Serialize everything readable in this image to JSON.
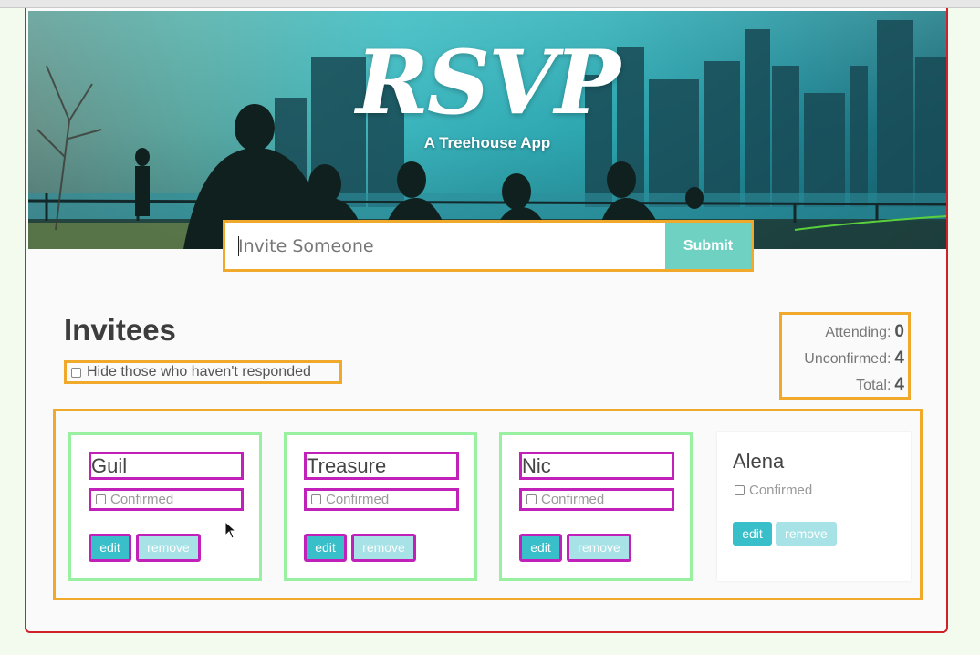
{
  "header": {
    "logo_text": "RSVP",
    "subtitle": "A Treehouse App"
  },
  "invite_form": {
    "placeholder": "Invite Someone",
    "submit_label": "Submit"
  },
  "main": {
    "title": "Invitees",
    "filter_label": "Hide those who haven't responded",
    "counter": {
      "attending_label": "Attending:",
      "attending_value": "0",
      "unconfirmed_label": "Unconfirmed:",
      "unconfirmed_value": "4",
      "total_label": "Total:",
      "total_value": "4"
    },
    "invitees": [
      {
        "name": "Guil",
        "confirmed_label": "Confirmed",
        "edit_label": "edit",
        "remove_label": "remove"
      },
      {
        "name": "Treasure",
        "confirmed_label": "Confirmed",
        "edit_label": "edit",
        "remove_label": "remove"
      },
      {
        "name": "Nic",
        "confirmed_label": "Confirmed",
        "edit_label": "edit",
        "remove_label": "remove"
      },
      {
        "name": "Alena",
        "confirmed_label": "Confirmed",
        "edit_label": "edit",
        "remove_label": "remove"
      }
    ]
  },
  "colors": {
    "accent_teal": "#38bfc9",
    "submit_teal": "#6ed1c2",
    "highlight_orange": "#f0a92a",
    "highlight_green": "#98f0a0",
    "highlight_magenta": "#c121b8",
    "frame_red": "#d0202a"
  }
}
